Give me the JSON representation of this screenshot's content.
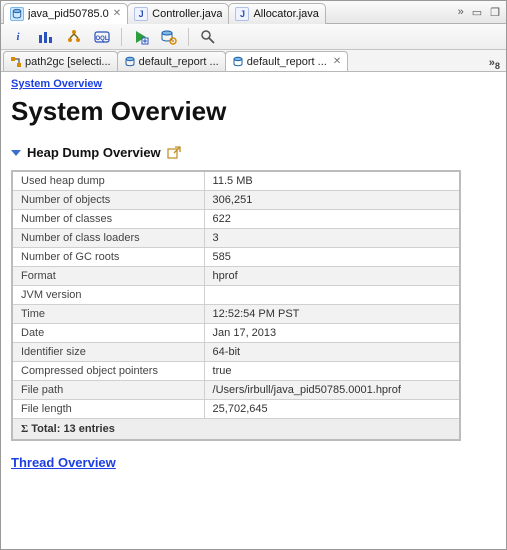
{
  "editorTabs": {
    "t0": {
      "label": "java_pid50785.0"
    },
    "t1": {
      "label": "Controller.java"
    },
    "t2": {
      "label": "Allocator.java"
    },
    "close": "✕",
    "overflow": "»"
  },
  "innerTabs": {
    "i0": {
      "label": "path2gc [selecti..."
    },
    "i1": {
      "label": "default_report ..."
    },
    "i2": {
      "label": "default_report ..."
    },
    "overflow": "»",
    "overflowCount": "8"
  },
  "breadcrumb": "System Overview",
  "title": "System Overview",
  "section": {
    "heapDump": "Heap Dump Overview",
    "threadNext": "Thread Overview"
  },
  "rows": {
    "usedHeap": {
      "k": "Used heap dump",
      "v": "11.5 MB"
    },
    "numObjects": {
      "k": "Number of objects",
      "v": "306,251"
    },
    "numClasses": {
      "k": "Number of classes",
      "v": "622"
    },
    "numClassLoaders": {
      "k": "Number of class loaders",
      "v": "3"
    },
    "numGCRoots": {
      "k": "Number of GC roots",
      "v": "585"
    },
    "format": {
      "k": "Format",
      "v": "hprof"
    },
    "jvmVersion": {
      "k": "JVM version",
      "v": ""
    },
    "time": {
      "k": "Time",
      "v": "12:52:54 PM PST"
    },
    "date": {
      "k": "Date",
      "v": "Jan 17, 2013"
    },
    "identSize": {
      "k": "Identifier size",
      "v": "64-bit"
    },
    "compressed": {
      "k": "Compressed object pointers",
      "v": "true"
    },
    "filePath": {
      "k": "File path",
      "v": "/Users/irbull/java_pid50785.0001.hprof"
    },
    "fileLength": {
      "k": "File length",
      "v": "25,702,645"
    }
  },
  "footer": "Total: 13 entries",
  "icons": {
    "i": "i",
    "J": "J"
  }
}
